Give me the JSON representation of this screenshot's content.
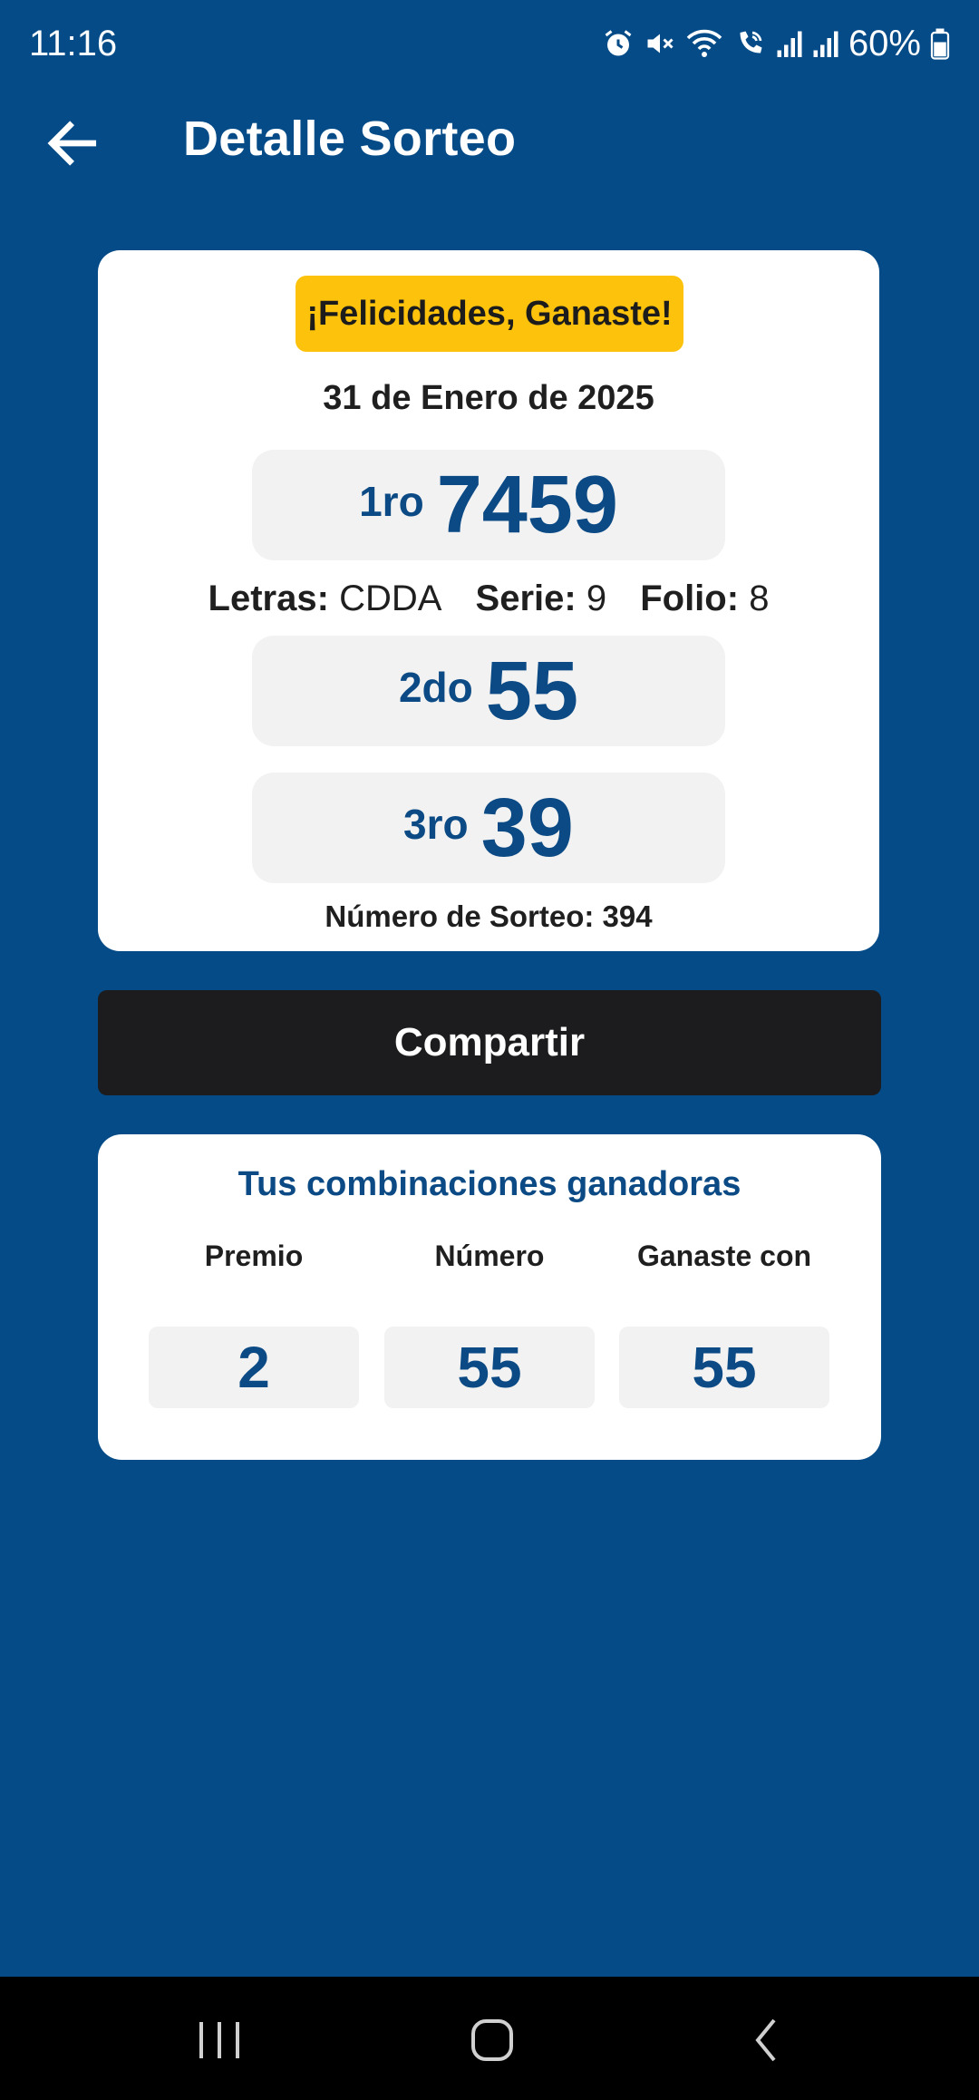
{
  "status_bar": {
    "time": "11:16",
    "battery": "60%",
    "icons": [
      "alarm-icon",
      "mute-icon",
      "wifi-icon",
      "wifi-calling-icon",
      "signal-icon",
      "signal-icon",
      "battery-icon"
    ]
  },
  "app_bar": {
    "title": "Detalle Sorteo",
    "back_icon": "arrow-left-icon"
  },
  "result": {
    "badge": "¡Felicidades, Ganaste!",
    "date": "31 de Enero de 2025",
    "first": {
      "label": "1ro",
      "number": "7459"
    },
    "letras_label": "Letras:",
    "letras_value": "CDDA",
    "serie_label": "Serie:",
    "serie_value": "9",
    "folio_label": "Folio:",
    "folio_value": "8",
    "second": {
      "label": "2do",
      "number": "55"
    },
    "third": {
      "label": "3ro",
      "number": "39"
    },
    "sorteo_label": "Número de Sorteo: 394"
  },
  "share_button": "Compartir",
  "combinations": {
    "title": "Tus combinaciones ganadoras",
    "headers": [
      "Premio",
      "Número",
      "Ganaste con"
    ],
    "rows": [
      [
        "2",
        "55",
        "55"
      ]
    ]
  },
  "nav_bar": {
    "buttons": [
      "recents-icon",
      "home-icon",
      "back-icon"
    ]
  },
  "colors": {
    "background": "#044b87",
    "badge": "#fdc20b",
    "accent_text": "#0b4a84",
    "share_button": "#1c1c1e",
    "card": "#ffffff",
    "cell": "#f2f2f2"
  }
}
